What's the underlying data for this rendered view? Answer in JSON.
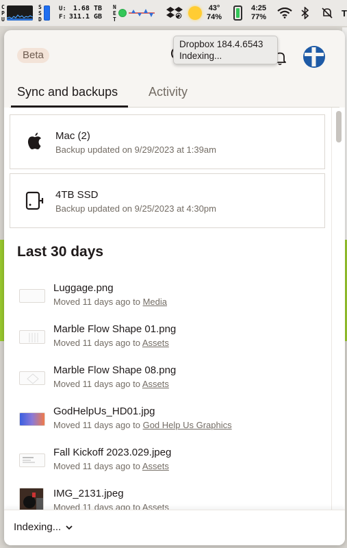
{
  "menubar": {
    "cpu_label": "C\nP\nU",
    "ssd_label": "S\nS\nD",
    "disk_label": "U:\nF:",
    "disk_used": "1.68 TB",
    "disk_free": "311.1 GB",
    "net_label": "N\nE\nT",
    "temperature": "43°",
    "humidity": "74%",
    "time": "4:25",
    "battery_percent": "77%",
    "partial_right": "T"
  },
  "tooltip": {
    "line1": "Dropbox 184.4.6543",
    "line2": "Indexing..."
  },
  "header": {
    "badge": "Beta"
  },
  "tabs": [
    {
      "label": "Sync and backups",
      "active": true
    },
    {
      "label": "Activity",
      "active": false
    }
  ],
  "devices": [
    {
      "icon": "apple-icon",
      "name": "Mac (2)",
      "status": "Backup updated on 9/29/2023 at 1:39am"
    },
    {
      "icon": "external-drive-icon",
      "name": "4TB SSD",
      "status": "Backup updated on 9/25/2023 at 4:30pm"
    }
  ],
  "section_title": "Last 30 days",
  "files": [
    {
      "name": "Luggage.png",
      "action": "Moved 11 days ago to ",
      "folder": "Media"
    },
    {
      "name": "Marble Flow Shape 01.png",
      "action": "Moved 11 days ago to ",
      "folder": "Assets"
    },
    {
      "name": "Marble Flow Shape 08.png",
      "action": "Moved 11 days ago to ",
      "folder": "Assets"
    },
    {
      "name": "GodHelpUs_HD01.jpg",
      "action": "Moved 11 days ago to ",
      "folder": "God Help Us Graphics"
    },
    {
      "name": "Fall Kickoff 2023.029.jpeg",
      "action": "Moved 11 days ago to ",
      "folder": "Assets"
    },
    {
      "name": "IMG_2131.jpeg",
      "action": "Moved 11 days ago to ",
      "folder": "Assets"
    }
  ],
  "footer": {
    "status": "Indexing..."
  },
  "colors": {
    "accent_green": "#34c759",
    "badge_bg": "#f3e3d8",
    "text_primary": "#1e1919",
    "text_secondary": "#736c64"
  }
}
